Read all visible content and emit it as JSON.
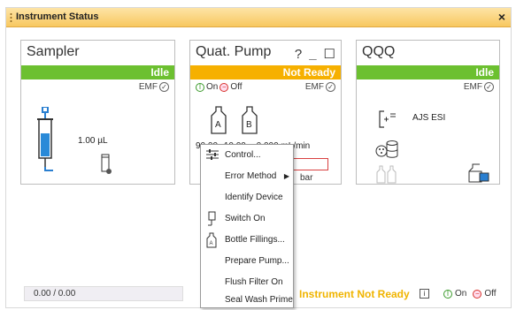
{
  "window": {
    "title": "Instrument Status",
    "close_glyph": "×"
  },
  "sampler": {
    "title": "Sampler",
    "status": "Idle",
    "emf": "EMF",
    "volume": "1.00 µL"
  },
  "pump": {
    "title": "Quat. Pump",
    "help_glyph": "?",
    "minimize_glyph": "_",
    "maximize_glyph": "☐",
    "status": "Not Ready",
    "on_label": "On",
    "off_label": "Off",
    "emf": "EMF",
    "bottle_a": "A",
    "bottle_b": "B",
    "flow_a": "90.00",
    "flow_b": "10.00",
    "flow_rate": "0.000 mL/min",
    "pressure_unit": "bar"
  },
  "qqq": {
    "title": "QQQ",
    "status": "Idle",
    "emf": "EMF",
    "source": "AJS ESI"
  },
  "context_menu": {
    "items": [
      {
        "label": "Control...",
        "icon": "sliders-icon"
      },
      {
        "label": "Error Method",
        "icon": "",
        "submenu": true
      },
      {
        "label": "Identify Device",
        "icon": ""
      },
      {
        "label": "Switch On",
        "icon": "switch-icon"
      },
      {
        "label": "Bottle Fillings...",
        "icon": "bottle-icon"
      },
      {
        "label": "Prepare Pump...",
        "icon": ""
      },
      {
        "label": "Flush Filter On",
        "icon": ""
      },
      {
        "label": "Seal Wash Prime",
        "icon": ""
      }
    ]
  },
  "footer": {
    "progress": "0.00 / 0.00",
    "instrument_status": "Instrument Not Ready",
    "info_glyph": "i",
    "on_label": "On",
    "off_label": "Off"
  },
  "colors": {
    "idle": "#6cc030",
    "not_ready": "#f6b000",
    "title_bar": "#f8c860"
  }
}
